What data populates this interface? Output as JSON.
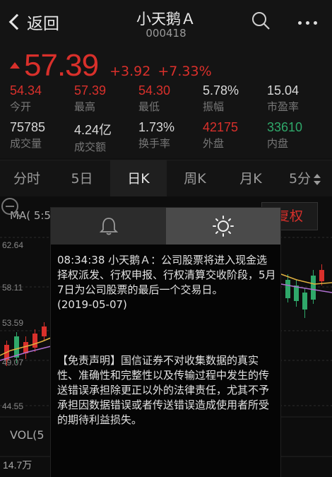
{
  "header": {
    "back_label": "返回",
    "stock_name": "小天鹅Ａ",
    "stock_code": "000418"
  },
  "quote": {
    "price": "57.39",
    "change": "+3.92",
    "change_pct": "+7.33%",
    "stats": [
      {
        "value": "54.34",
        "label": "今开",
        "color": "red"
      },
      {
        "value": "57.39",
        "label": "最高",
        "color": "red"
      },
      {
        "value": "54.30",
        "label": "最低",
        "color": "red"
      },
      {
        "value": "5.78%",
        "label": "振幅",
        "color": "white"
      },
      {
        "value": "15.04",
        "label": "市盈率",
        "color": "white"
      },
      {
        "value": "75785",
        "label": "成交量",
        "color": "white"
      },
      {
        "value": "4.24亿",
        "label": "成交额",
        "color": "white"
      },
      {
        "value": "1.73%",
        "label": "换手率",
        "color": "white"
      },
      {
        "value": "42175",
        "label": "外盘",
        "color": "red"
      },
      {
        "value": "33610",
        "label": "内盘",
        "color": "green"
      }
    ]
  },
  "tabs": [
    "分时",
    "5日",
    "日K",
    "周K",
    "月K",
    "5分"
  ],
  "chart": {
    "ma_label": "MA( 5:5",
    "fuquan_label": "复权",
    "y_labels": [
      "62.64",
      "58.11",
      "53.59",
      "49.07",
      "44.55"
    ],
    "vol_label": "VOL(5",
    "vol_value": "14.7万"
  },
  "notice": {
    "text": "08:34:38 小天鹅Ａ：公司股票将进入现金选择权派发、行权申报、行权清算交收阶段，5月7日为公司股票的最后一个交易日。",
    "date": "(2019-05-07)",
    "disclaimer": "【免责声明】国信证券不对收集数据的真实性、准确性和完整性以及传输过程中发生的传送错误承担除更正以外的法律责任，尤其不予承担因数据错误或者传送错误造成使用者所受的期待利益损失。"
  },
  "colors": {
    "up": "#d9302b",
    "down": "#2fa86a"
  }
}
